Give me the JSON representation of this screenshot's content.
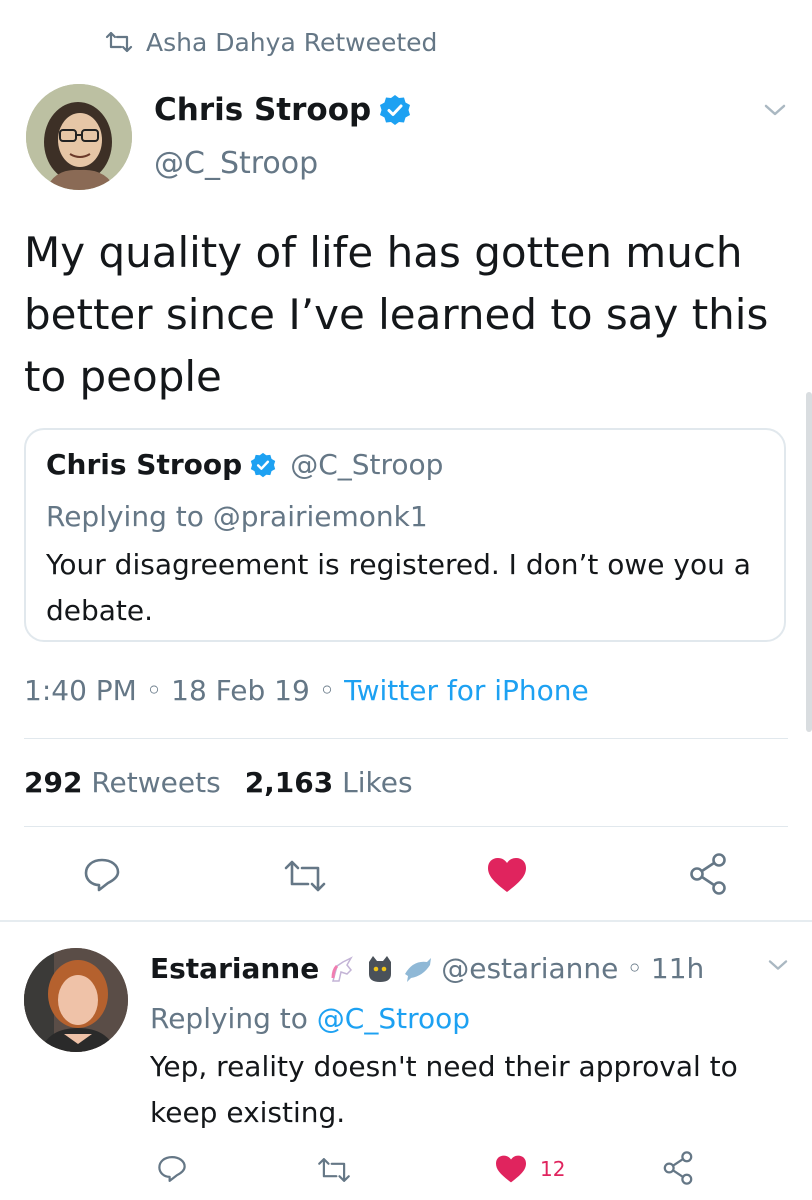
{
  "retweet_header": {
    "label": "Asha Dahya Retweeted"
  },
  "tweet": {
    "author_name": "Chris Stroop",
    "author_handle": "@C_Stroop",
    "text": "My quality of life has gotten much better since I’ve learned to say this to people",
    "quote": {
      "author_name": "Chris Stroop",
      "author_handle": "@C_Stroop",
      "replying_prefix": "Replying to ",
      "replying_to": "@prairiemonk1",
      "text": "Your disagreement is registered. I don’t owe you a debate."
    },
    "time": "1:40 PM",
    "date": "18 Feb 19",
    "source": "Twitter for iPhone",
    "retweet_count": "292",
    "retweet_label": "Retweets",
    "like_count": "2,163",
    "like_label": "Likes"
  },
  "reply": {
    "author_name": "Estarianne",
    "author_handle": "@estarianne",
    "age": "11h",
    "replying_prefix": "Replying to ",
    "replying_to": "@C_Stroop",
    "text": "Yep, reality doesn't need their approval to keep existing.",
    "like_count": "12"
  },
  "colors": {
    "accent": "#1da1f2",
    "like": "#e0245e",
    "secondary_text": "#657786",
    "divider": "#e1e8ed"
  },
  "icons": {
    "retweet": "retweet-icon",
    "verified": "verified-badge-icon",
    "caret": "chevron-down-icon",
    "reply": "reply-icon",
    "like": "heart-icon",
    "share": "share-icon"
  }
}
